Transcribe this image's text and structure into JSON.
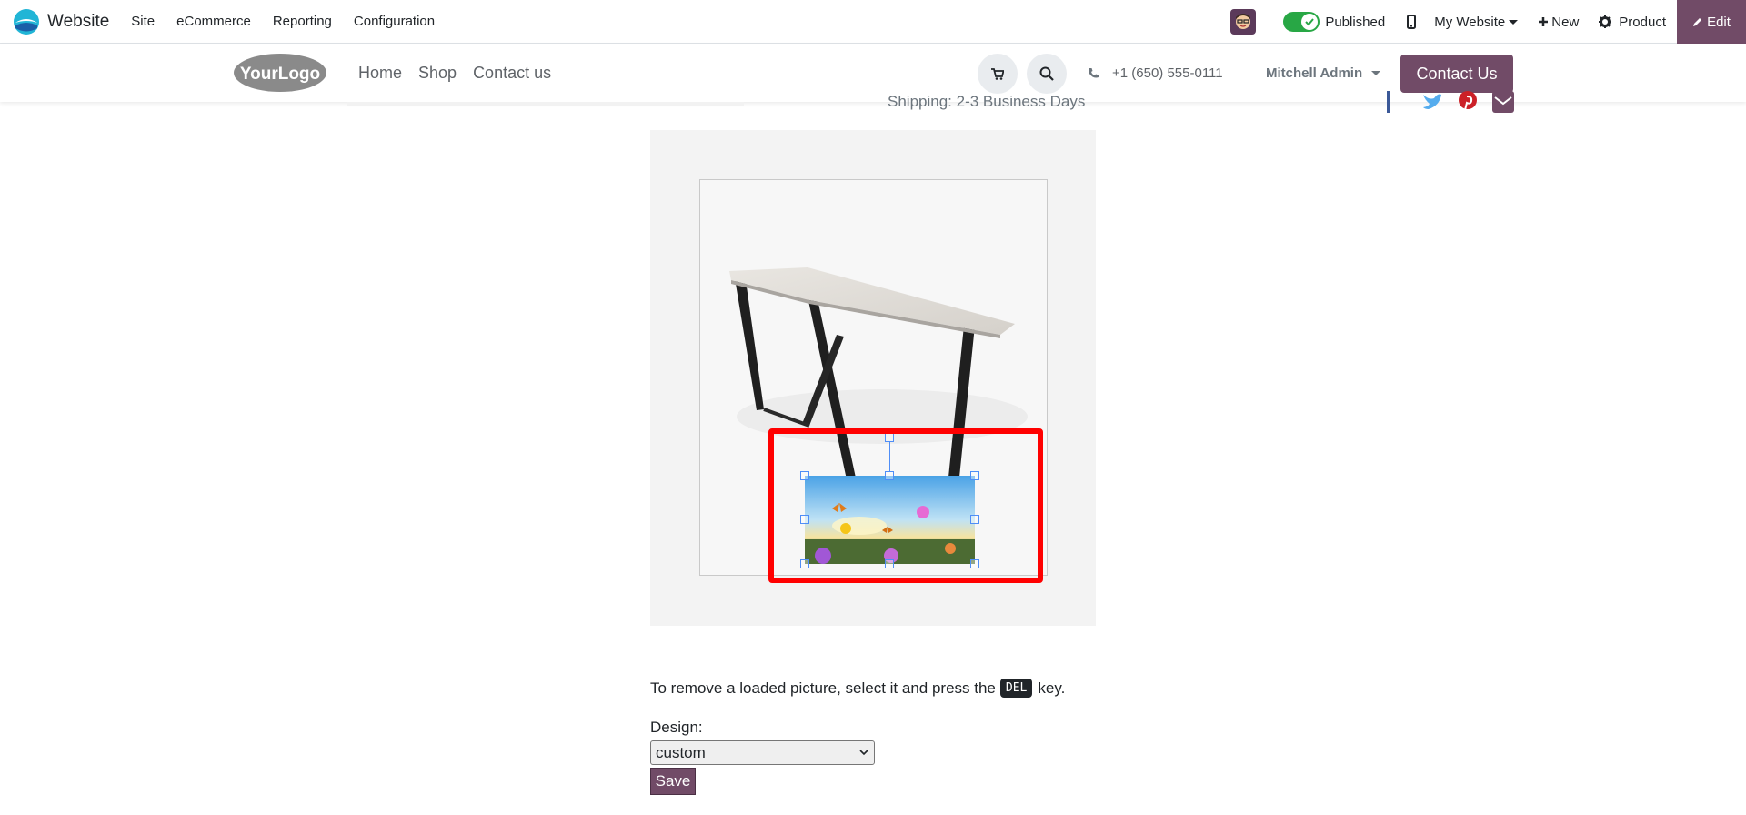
{
  "app": {
    "name": "Website",
    "menu": [
      "Site",
      "eCommerce",
      "Reporting",
      "Configuration"
    ],
    "published_label": "Published",
    "website_selector": "My Website",
    "new_label": "New",
    "product_label": "Product",
    "edit_label": "Edit"
  },
  "site": {
    "logo_text": "YourLogo",
    "nav": [
      "Home",
      "Shop",
      "Contact us"
    ],
    "phone": "+1 (650) 555-0111",
    "user": "Mitchell Admin",
    "contact_button": "Contact Us",
    "shipping": "Shipping: 2-3 Business Days"
  },
  "editor": {
    "hint_before": "To remove a loaded picture, select it and press the",
    "hint_key": "DEL",
    "hint_after": "key.",
    "design_label": "Design:",
    "design_value": "custom",
    "save_label": "Save"
  },
  "colors": {
    "brand": "#714b67",
    "toggle_on": "#28a745",
    "highlight": "#ff0000"
  },
  "icons": [
    "odoo-logo-icon",
    "toggle-check-icon",
    "mobile-icon",
    "plus-icon",
    "gear-icon",
    "pencil-icon",
    "cart-icon",
    "search-icon",
    "phone-icon",
    "facebook-icon",
    "twitter-icon",
    "pinterest-icon",
    "email-icon"
  ]
}
